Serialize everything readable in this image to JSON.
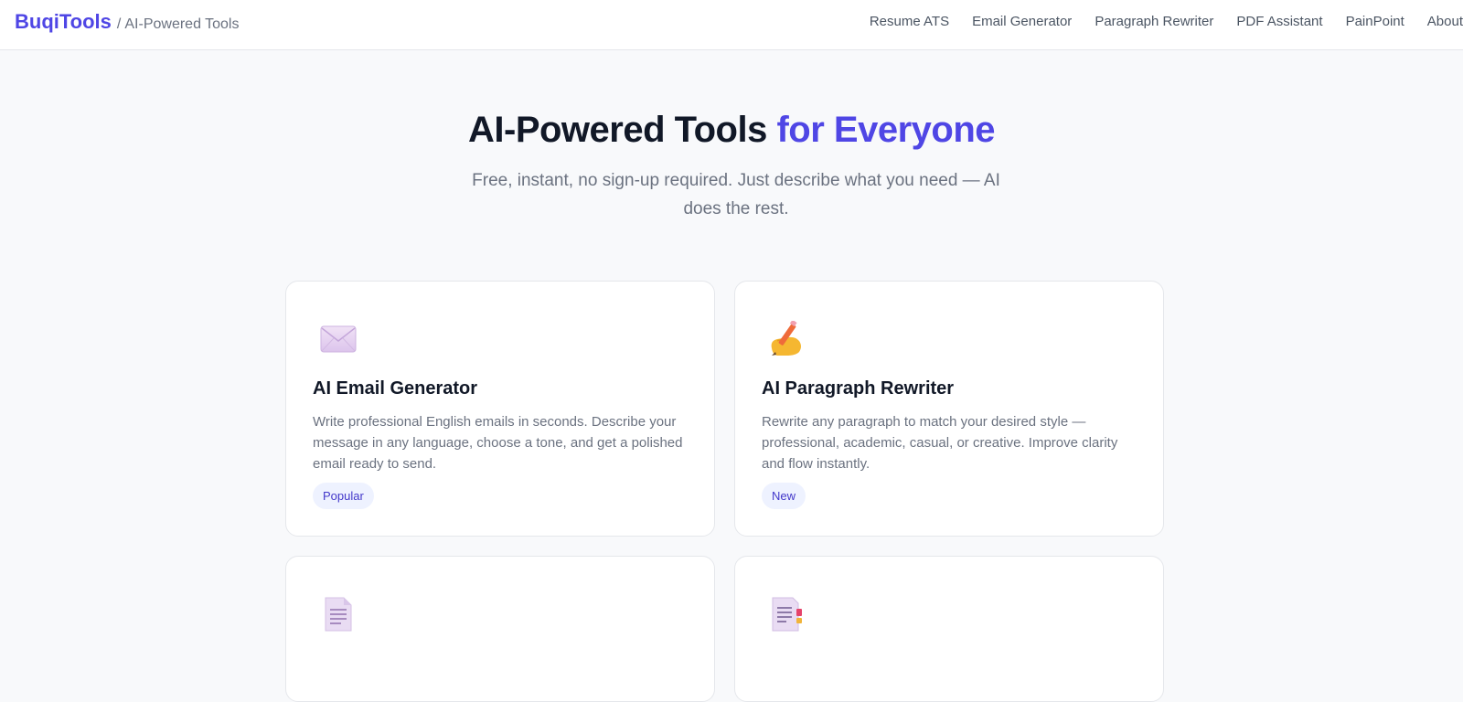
{
  "nav": {
    "brand": "BuqiTools",
    "separator": "/",
    "subtitle": "AI-Powered Tools",
    "links": [
      "Resume ATS",
      "Email Generator",
      "Paragraph Rewriter",
      "PDF Assistant",
      "PainPoint",
      "About"
    ]
  },
  "hero": {
    "title_main": "AI-Powered Tools",
    "title_accent": "for Everyone",
    "subtitle": "Free, instant, no sign-up required. Just describe what you need — AI does the rest."
  },
  "cards": [
    {
      "icon": "envelope-icon",
      "title": "AI Email Generator",
      "description": "Write professional English emails in seconds. Describe your message in any language, choose a tone, and get a polished email ready to send.",
      "badge": "Popular"
    },
    {
      "icon": "writing-hand-icon",
      "title": "AI Paragraph Rewriter",
      "description": "Rewrite any paragraph to match your desired style — professional, academic, casual, or creative. Improve clarity and flow instantly.",
      "badge": "New"
    },
    {
      "icon": "document-icon",
      "title": "",
      "description": "",
      "badge": ""
    },
    {
      "icon": "document-edit-icon",
      "title": "",
      "description": "",
      "badge": ""
    }
  ],
  "colors": {
    "accent": "#4f46e5",
    "badge_bg": "#eef2ff",
    "badge_text": "#4338ca",
    "page_bg": "#f8f9fb"
  }
}
